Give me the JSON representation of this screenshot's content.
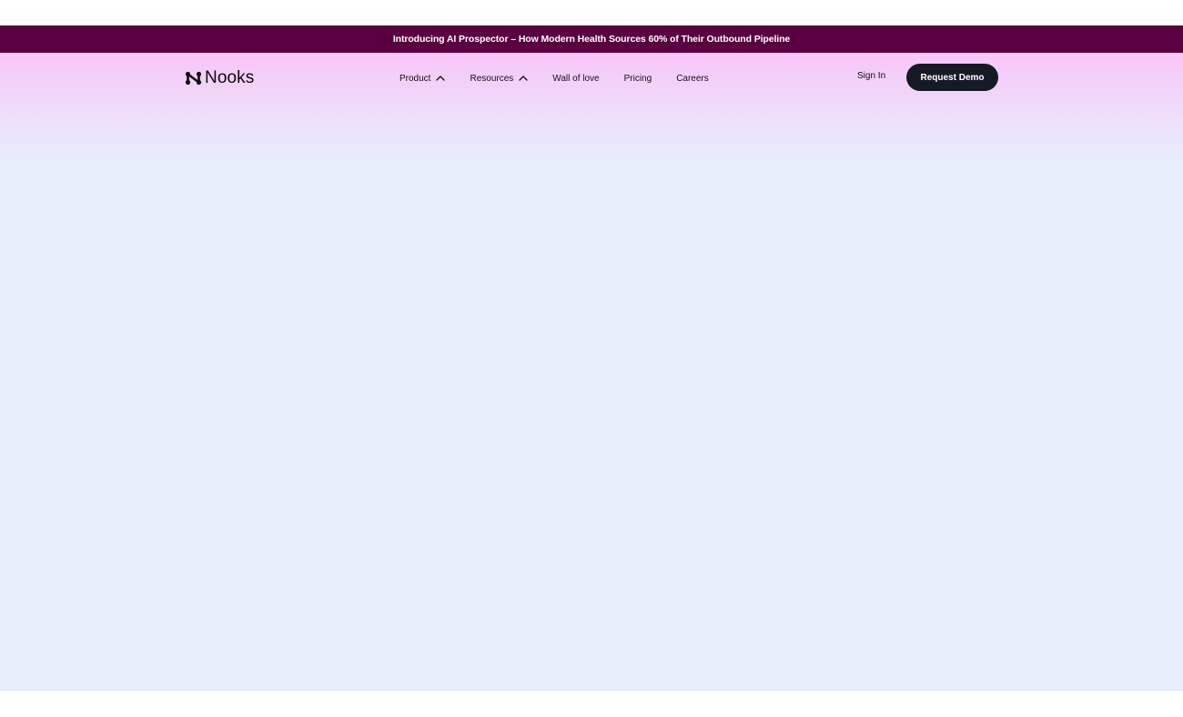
{
  "announcement": {
    "text": "Introducing AI Prospector – How Modern Health Sources 60% of Their Outbound Pipeline"
  },
  "nav": {
    "logo_text": "Nooks",
    "links": [
      {
        "label": "Product",
        "icon": "chevron-up-icon"
      },
      {
        "label": "Resources",
        "icon": "chevron-up-icon"
      },
      {
        "label": "Wall of love"
      },
      {
        "label": "Pricing"
      },
      {
        "label": "Careers"
      }
    ],
    "sign_in": "Sign In",
    "cta": "Request Demo"
  },
  "colors": {
    "announcement_bg": "#5a0040",
    "hero_gradient_top": "#f7c6fa",
    "page_bg": "#e8eefc",
    "cta_bg": "#161a26"
  }
}
